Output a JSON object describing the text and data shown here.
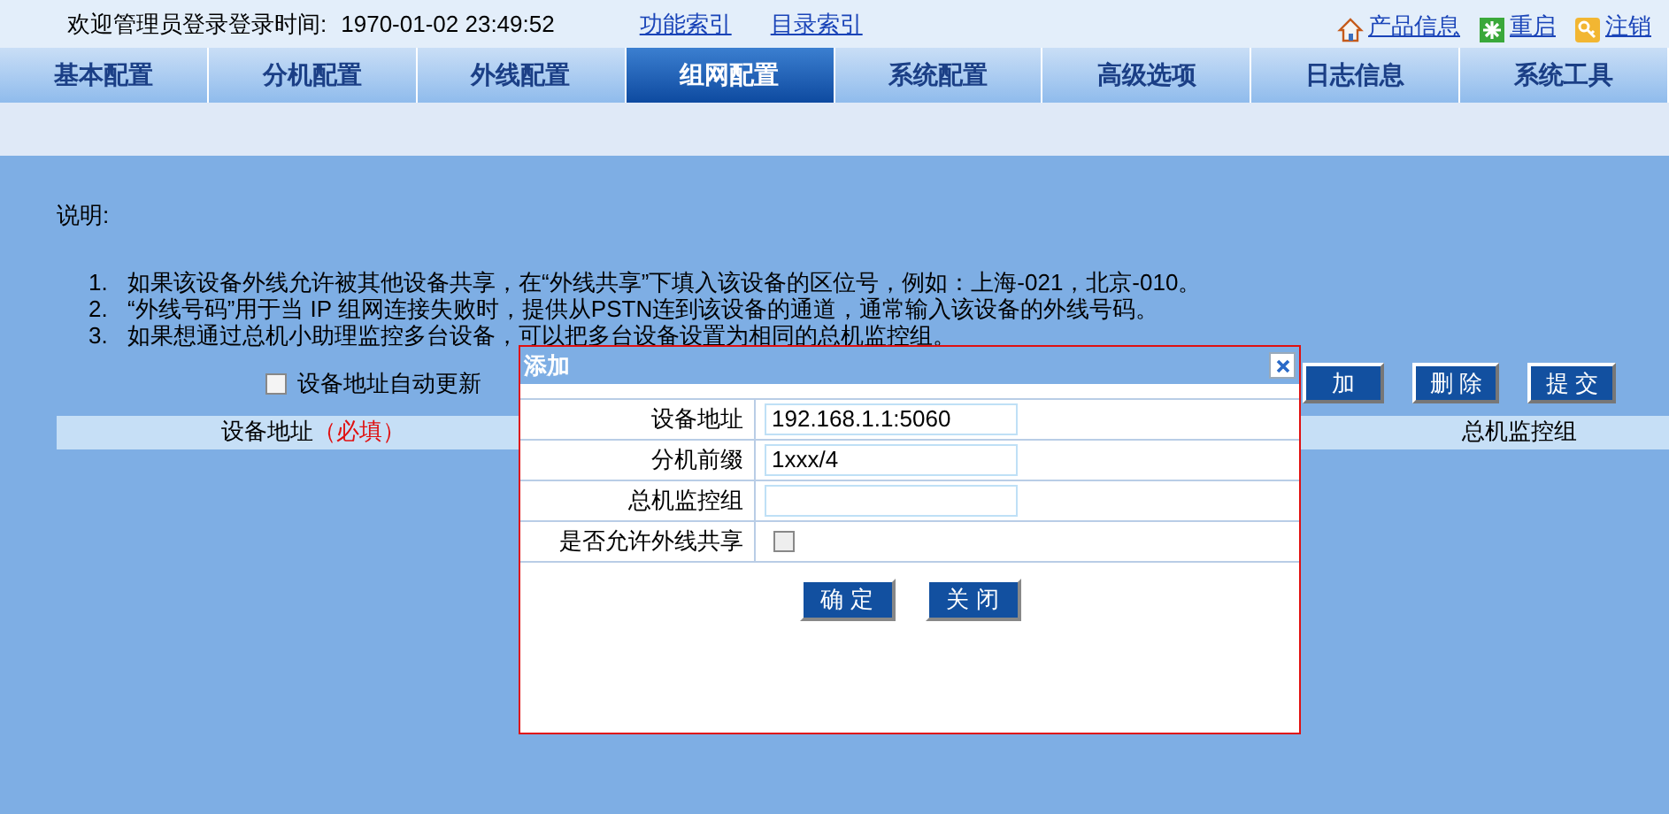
{
  "header": {
    "welcome": "欢迎管理员登录登录时间:",
    "login_time": "1970-01-02 23:49:52",
    "links": [
      {
        "label": "功能索引"
      },
      {
        "label": "目录索引"
      }
    ],
    "actions": [
      {
        "kind": "home",
        "label": "产品信息"
      },
      {
        "kind": "restart",
        "label": "重启"
      },
      {
        "kind": "logout",
        "label": "注销"
      }
    ]
  },
  "tabs": [
    {
      "label": "基本配置",
      "selected": false
    },
    {
      "label": "分机配置",
      "selected": false
    },
    {
      "label": "外线配置",
      "selected": false
    },
    {
      "label": "组网配置",
      "selected": true
    },
    {
      "label": "系统配置",
      "selected": false
    },
    {
      "label": "高级选项",
      "selected": false
    },
    {
      "label": "日志信息",
      "selected": false
    },
    {
      "label": "系统工具",
      "selected": false
    }
  ],
  "notes": {
    "title": "说明:",
    "items": [
      {
        "number": "1.",
        "text": "如果该设备外线允许被其他设备共享，在“外线共享”下填入该设备的区位号，例如：上海-021，北京-010。"
      },
      {
        "number": "2.",
        "text": "“外线号码”用于当 IP 组网连接失败时，提供从PSTN连到该设备的通道，通常输入该设备的外线号码。"
      },
      {
        "number": "3.",
        "text": "如果想通过总机小助理监控多台设备，可以把多台设备设置为相同的总机监控组。"
      }
    ]
  },
  "auto_update": {
    "label": "设备地址自动更新",
    "checked": false
  },
  "toolbar_buttons": [
    {
      "label": "加"
    },
    {
      "label": "删 除"
    },
    {
      "label": "提 交"
    }
  ],
  "table": {
    "columns": [
      {
        "label": "设备地址",
        "required": "（必填）"
      },
      {
        "label": "总机监控组"
      }
    ]
  },
  "dialog": {
    "title": "添加",
    "fields": [
      {
        "kind": "text",
        "label": "设备地址",
        "value": "192.168.1.1:5060"
      },
      {
        "kind": "text",
        "label": "分机前缀",
        "value": "1xxx/4"
      },
      {
        "kind": "text",
        "label": "总机监控组"
      },
      {
        "kind": "checkbox",
        "label": "是否允许外线共享",
        "checked": false
      }
    ],
    "buttons": [
      {
        "label": "确 定"
      },
      {
        "label": "关 闭"
      }
    ]
  }
}
